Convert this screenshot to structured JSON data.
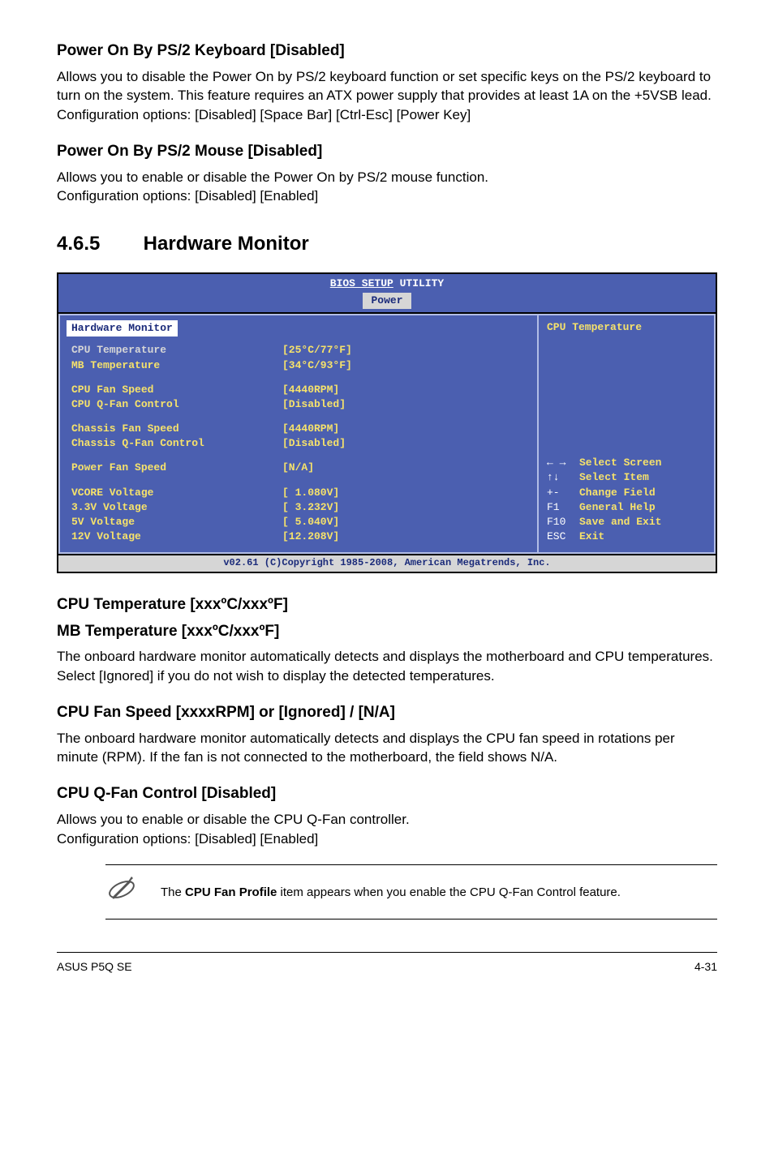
{
  "sec1": {
    "h": "Power On By PS/2 Keyboard [Disabled]",
    "p1": "Allows you to disable the Power On by PS/2 keyboard function or set specific keys on the PS/2 keyboard to turn on the system. This feature requires an ATX power supply that provides at least 1A on the +5VSB lead.",
    "p2": "Configuration options: [Disabled] [Space Bar] [Ctrl-Esc] [Power Key]"
  },
  "sec2": {
    "h": "Power On By PS/2 Mouse [Disabled]",
    "p1": "Allows you to enable or disable the Power On by PS/2 mouse function.",
    "p2": "Configuration options: [Disabled] [Enabled]"
  },
  "bigsection": {
    "num": "4.6.5",
    "title": "Hardware Monitor"
  },
  "bios": {
    "title1": "BIOS SETUP",
    "title2": " UTILITY",
    "tab": "Power",
    "panelTitle": "Hardware Monitor",
    "rightTop": "CPU Temperature",
    "rows": [
      {
        "lab": "CPU Temperature",
        "val": "[25°C/77°F]",
        "white": true
      },
      {
        "lab": "MB Temperature",
        "val": "[34°C/93°F]"
      },
      {
        "gap": true
      },
      {
        "lab": "CPU Fan Speed",
        "val": "[4440RPM]"
      },
      {
        "lab": "CPU Q-Fan Control",
        "val": "[Disabled]"
      },
      {
        "gap": true
      },
      {
        "lab": "Chassis Fan Speed",
        "val": "[4440RPM]"
      },
      {
        "lab": "Chassis Q-Fan Control",
        "val": "[Disabled]"
      },
      {
        "gap": true
      },
      {
        "lab": "Power Fan Speed",
        "val": "[N/A]"
      },
      {
        "gap": true
      },
      {
        "lab": "VCORE Voltage",
        "val": "[ 1.080V]"
      },
      {
        "lab": "3.3V Voltage",
        "val": "[ 3.232V]"
      },
      {
        "lab": "5V Voltage",
        "val": "[ 5.040V]"
      },
      {
        "lab": "12V Voltage",
        "val": "[12.208V]"
      }
    ],
    "keys": [
      {
        "k": "←→",
        "d": "Select Screen",
        "sym": "lr"
      },
      {
        "k": "↑↓",
        "d": "Select Item",
        "sym": "ud"
      },
      {
        "k": "+-",
        "d": "Change Field"
      },
      {
        "k": "F1",
        "d": "General Help"
      },
      {
        "k": "F10",
        "d": "Save and Exit"
      },
      {
        "k": "ESC",
        "d": "Exit"
      }
    ],
    "footer": "v02.61 (C)Copyright 1985-2008, American Megatrends, Inc."
  },
  "sec3": {
    "h1": "CPU Temperature [xxxºC/xxxºF]",
    "h2": "MB Temperature [xxxºC/xxxºF]",
    "p": "The onboard hardware monitor automatically detects and displays the motherboard and CPU temperatures. Select [Ignored] if you do not wish to display the detected temperatures."
  },
  "sec4": {
    "h": "CPU Fan Speed [xxxxRPM] or [Ignored] / [N/A]",
    "p": "The onboard hardware monitor automatically detects and displays the CPU fan speed in rotations per minute (RPM). If the fan is not connected to the motherboard, the field shows N/A."
  },
  "sec5": {
    "h": "CPU Q-Fan Control [Disabled]",
    "p1": "Allows you to enable or disable the CPU Q-Fan controller.",
    "p2": "Configuration options: [Disabled] [Enabled]"
  },
  "note": {
    "pre": "The ",
    "bold": "CPU Fan Profile",
    "post": " item appears when you enable the CPU Q-Fan Control feature."
  },
  "footer": {
    "left": "ASUS P5Q SE",
    "right": "4-31"
  }
}
